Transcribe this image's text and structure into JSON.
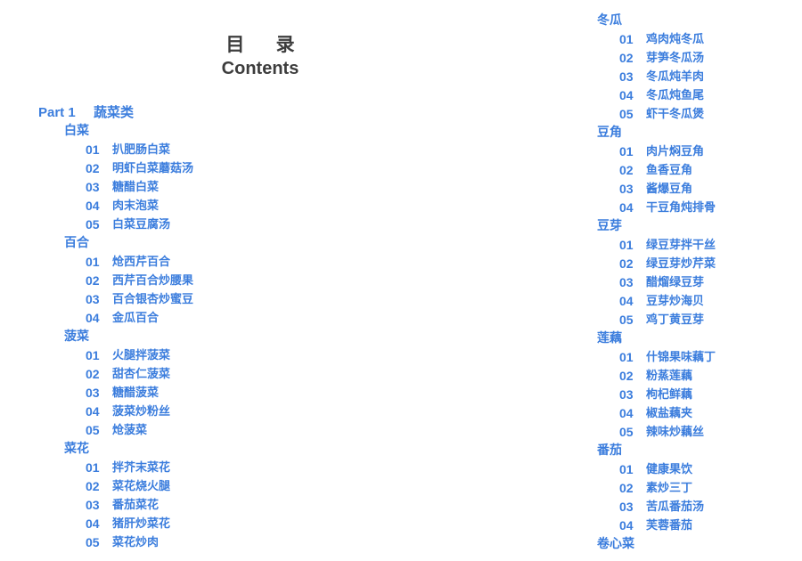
{
  "header": {
    "title_cn": "目 录",
    "title_en": "Contents"
  },
  "left_column": {
    "part": {
      "number": "Part 1",
      "name": "蔬菜类"
    },
    "categories": [
      {
        "name": "白菜",
        "items": [
          {
            "num": "01",
            "name": "扒肥肠白菜"
          },
          {
            "num": "02",
            "name": "明虾白菜蘑菇汤"
          },
          {
            "num": "03",
            "name": "糖醋白菜"
          },
          {
            "num": "04",
            "name": "肉末泡菜"
          },
          {
            "num": "05",
            "name": "白菜豆腐汤"
          }
        ]
      },
      {
        "name": "百合",
        "items": [
          {
            "num": "01",
            "name": "炝西芹百合"
          },
          {
            "num": "02",
            "name": "西芹百合炒腰果"
          },
          {
            "num": "03",
            "name": "百合银杏炒蜜豆"
          },
          {
            "num": "04",
            "name": "金瓜百合"
          }
        ]
      },
      {
        "name": "菠菜",
        "items": [
          {
            "num": "01",
            "name": "火腿拌菠菜"
          },
          {
            "num": "02",
            "name": "甜杏仁菠菜"
          },
          {
            "num": "03",
            "name": "糖醋菠菜"
          },
          {
            "num": "04",
            "name": "菠菜炒粉丝"
          },
          {
            "num": "05",
            "name": "炝菠菜"
          }
        ]
      },
      {
        "name": "菜花",
        "items": [
          {
            "num": "01",
            "name": "拌芥末菜花"
          },
          {
            "num": "02",
            "name": "菜花烧火腿"
          },
          {
            "num": "03",
            "name": "番茄菜花"
          },
          {
            "num": "04",
            "name": "猪肝炒菜花"
          },
          {
            "num": "05",
            "name": "菜花炒肉"
          }
        ]
      }
    ]
  },
  "right_column": {
    "categories": [
      {
        "name": "冬瓜",
        "items": [
          {
            "num": "01",
            "name": "鸡肉炖冬瓜"
          },
          {
            "num": "02",
            "name": "芽笋冬瓜汤"
          },
          {
            "num": "03",
            "name": "冬瓜炖羊肉"
          },
          {
            "num": "04",
            "name": "冬瓜炖鱼尾"
          },
          {
            "num": "05",
            "name": "虾干冬瓜煲"
          }
        ]
      },
      {
        "name": "豆角",
        "items": [
          {
            "num": "01",
            "name": "肉片焖豆角"
          },
          {
            "num": "02",
            "name": "鱼香豆角"
          },
          {
            "num": "03",
            "name": "酱爆豆角"
          },
          {
            "num": "04",
            "name": "干豆角炖排骨"
          }
        ]
      },
      {
        "name": "豆芽",
        "items": [
          {
            "num": "01",
            "name": "绿豆芽拌干丝"
          },
          {
            "num": "02",
            "name": "绿豆芽炒芹菜"
          },
          {
            "num": "03",
            "name": "醋熘绿豆芽"
          },
          {
            "num": "04",
            "name": "豆芽炒海贝"
          },
          {
            "num": "05",
            "name": "鸡丁黄豆芽"
          }
        ]
      },
      {
        "name": "莲藕",
        "items": [
          {
            "num": "01",
            "name": "什锦果味藕丁"
          },
          {
            "num": "02",
            "name": "粉蒸莲藕"
          },
          {
            "num": "03",
            "name": "枸杞鲜藕"
          },
          {
            "num": "04",
            "name": "椒盐藕夹"
          },
          {
            "num": "05",
            "name": "辣味炒藕丝"
          }
        ]
      },
      {
        "name": "番茄",
        "items": [
          {
            "num": "01",
            "name": "健康果饮"
          },
          {
            "num": "02",
            "name": "素炒三丁"
          },
          {
            "num": "03",
            "name": "苦瓜番茄汤"
          },
          {
            "num": "04",
            "name": "芙蓉番茄"
          }
        ]
      },
      {
        "name": "卷心菜",
        "items": []
      }
    ]
  }
}
